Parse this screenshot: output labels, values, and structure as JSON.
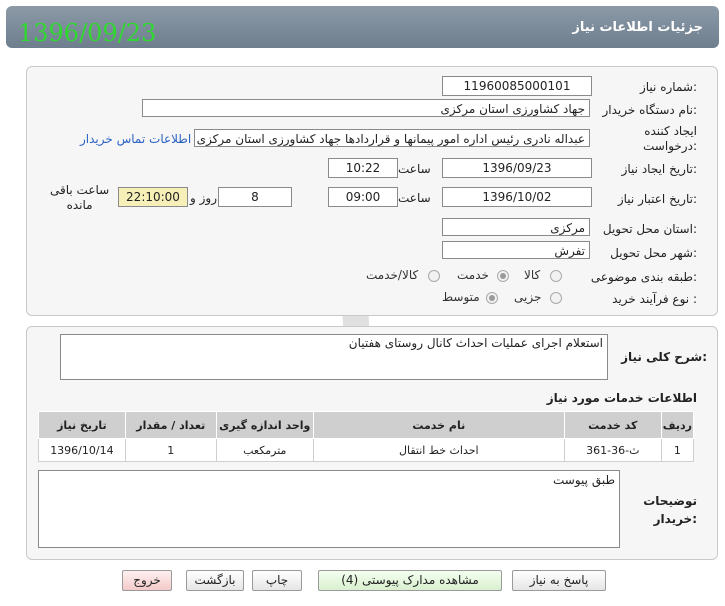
{
  "header": {
    "title": "جزئیات اطلاعات نیاز",
    "date_stamp": "1396/09/23"
  },
  "fields": {
    "need_number_label": "شماره نیاز:",
    "need_number": "1196008500010‏1",
    "buyer_label": "نام دستگاه خریدار:",
    "buyer": "جهاد کشاورزی استان مرکزی",
    "creator_label_line1": "ایجاد کننده",
    "creator_label_line2": "درخواست:",
    "creator": "عبداله نادری رئیس اداره امور پیمانها و قراردادها جهاد کشاورزی استان مرکزی",
    "contact_link": "اطلاعات تماس خریدار",
    "created_date_label": "تاریخ ایجاد نیاز:",
    "created_date": "1396/09/23",
    "time_label": "ساعت",
    "created_time": "10:22",
    "validity_label": "تاریخ اعتبار نیاز:",
    "validity_date": "1396/10/02",
    "validity_time": "09:00",
    "days": "8",
    "days_label": "روز و",
    "remaining": "22:10:00",
    "remaining_label_line1": "ساعت باقی",
    "remaining_label_line2": "مانده",
    "province_label": "استان محل تحویل:",
    "province": "مرکزی",
    "city_label": "شهر محل تحویل:",
    "city": "تفرش",
    "category_label": "طبقه بندی موضوعی:",
    "category_options": [
      "کالا",
      "خدمت",
      "کالا/خدمت"
    ],
    "process_label": "نوع فرآیند خرید :",
    "process_options": [
      "جزیی",
      "متوسط"
    ]
  },
  "description": {
    "label": "شرح کلی نیاز:",
    "text": "استعلام اجرای عملیات احداث کانال روستای هفتیان"
  },
  "services": {
    "title": "اطلاعات خدمات مورد نیاز",
    "columns": [
      "ردیف",
      "کد خدمت",
      "نام خدمت",
      "واحد اندازه گیری",
      "تعداد / مقدار",
      "تاریخ نیاز"
    ],
    "rows": [
      [
        "1",
        "ث-36-361",
        "احداث خط انتقال",
        "مترمکعب",
        "1",
        "1396/10/14"
      ]
    ]
  },
  "buyer_notes": {
    "label_line1": "توضیحات",
    "label_line2": "خریدار:",
    "text": "طبق پیوست"
  },
  "buttons": {
    "reply": "پاسخ به نیاز",
    "attachments": "مشاهده مدارک پیوستی (4)",
    "print": "چاپ",
    "back": "بازگشت",
    "exit": "خروج"
  },
  "colors": {
    "header_bg": "#7b8a98",
    "date_stamp": "#2fd92f",
    "link": "#2a62c4",
    "highlight": "#f7efb8"
  }
}
